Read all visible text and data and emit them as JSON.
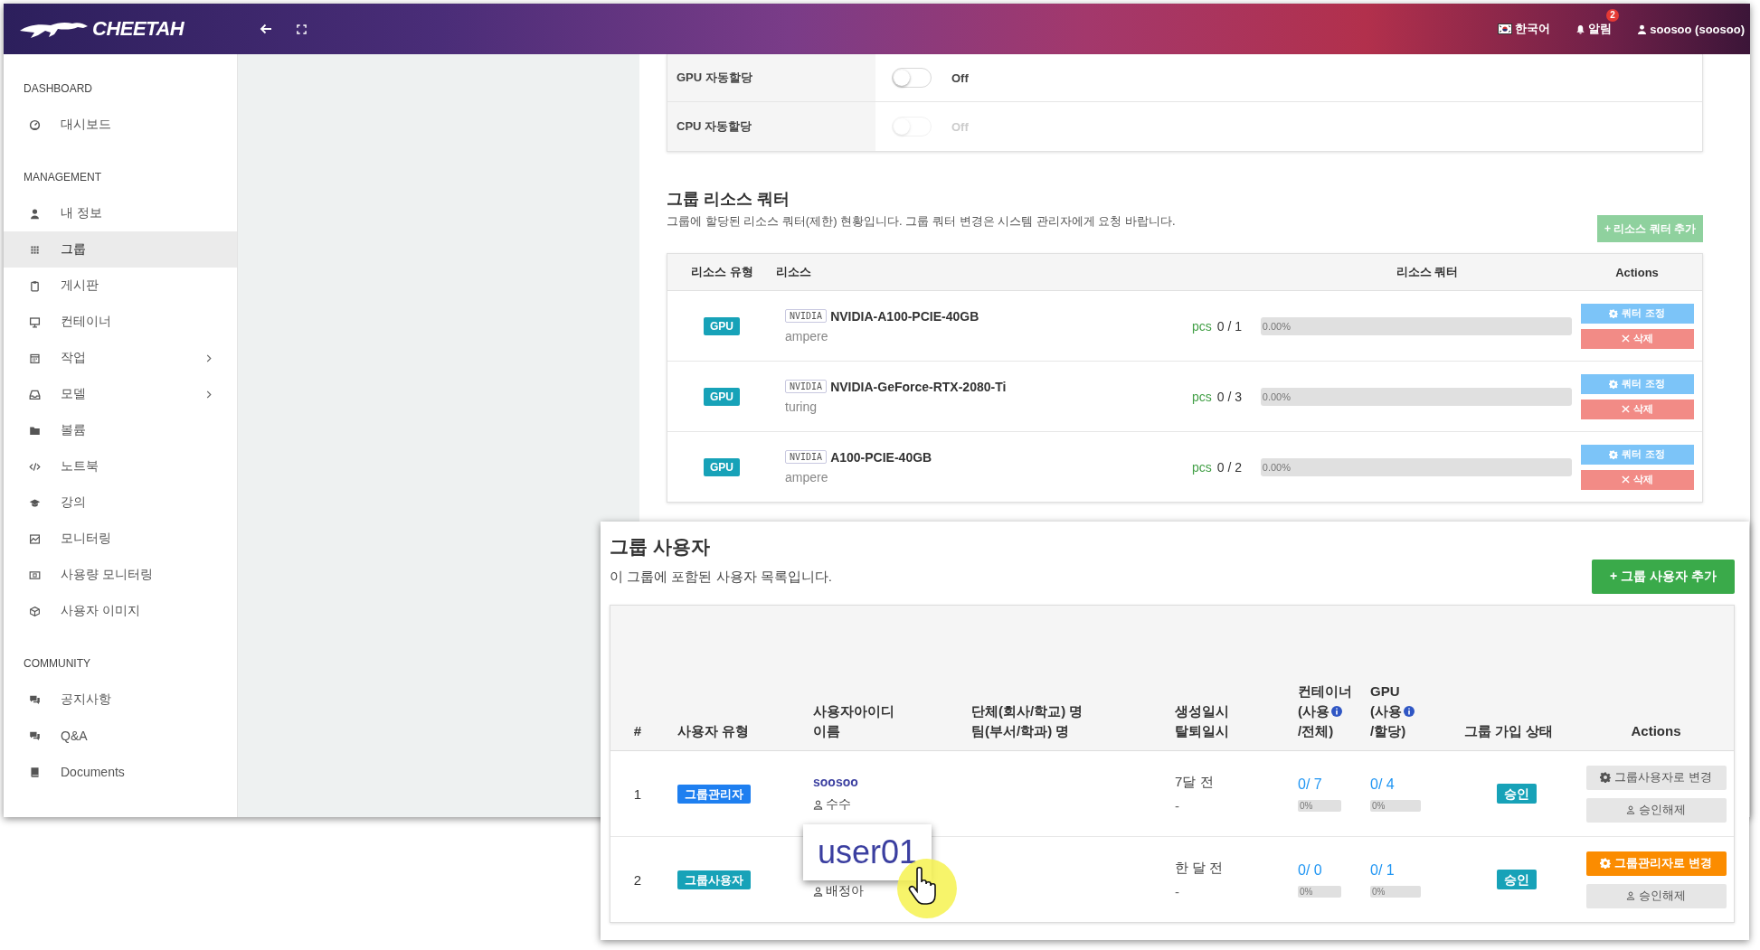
{
  "header": {
    "logo": "CHEETAH",
    "language": "한국어",
    "alerts": {
      "label": "알림",
      "count": "2"
    },
    "user": "soosoo (soosoo)"
  },
  "sidebar": {
    "sections": [
      {
        "title": "DASHBOARD",
        "items": [
          {
            "label": "대시보드",
            "selected": false,
            "expandable": false
          }
        ]
      },
      {
        "title": "MANAGEMENT",
        "items": [
          {
            "label": "내 정보",
            "selected": false,
            "expandable": false
          },
          {
            "label": "그룹",
            "selected": true,
            "expandable": false
          },
          {
            "label": "게시판",
            "selected": false,
            "expandable": false
          },
          {
            "label": "컨테이너",
            "selected": false,
            "expandable": false
          },
          {
            "label": "작업",
            "selected": false,
            "expandable": true
          },
          {
            "label": "모델",
            "selected": false,
            "expandable": true
          },
          {
            "label": "볼륨",
            "selected": false,
            "expandable": false
          },
          {
            "label": "노트북",
            "selected": false,
            "expandable": false
          },
          {
            "label": "강의",
            "selected": false,
            "expandable": false
          },
          {
            "label": "모니터링",
            "selected": false,
            "expandable": false
          },
          {
            "label": "사용량 모니터링",
            "selected": false,
            "expandable": false
          },
          {
            "label": "사용자 이미지",
            "selected": false,
            "expandable": false
          }
        ]
      },
      {
        "title": "COMMUNITY",
        "items": [
          {
            "label": "공지사항",
            "selected": false,
            "expandable": false
          },
          {
            "label": "Q&A",
            "selected": false,
            "expandable": false
          },
          {
            "label": "Documents",
            "selected": false,
            "expandable": false
          }
        ]
      }
    ]
  },
  "settings": [
    {
      "label": "GPU 자동할당",
      "on": false,
      "disabled": false,
      "status": "Off"
    },
    {
      "label": "CPU 자동할당",
      "on": false,
      "disabled": true,
      "status": "Off"
    }
  ],
  "quota": {
    "title": "그룹 리소스 쿼터",
    "description": "그룹에 할당된 리소스 쿼터(제한) 현황입니다. 그룹 쿼터 변경은 시스템 관리자에게 요청 바랍니다.",
    "add_button": "+ 리소스 쿼터 추가",
    "columns": [
      "리소스 유형",
      "리소스",
      "리소스 쿼터",
      "Actions"
    ],
    "rows": [
      {
        "type": "GPU",
        "vendor": "NVIDIA",
        "name": "NVIDIA-A100-PCIE-40GB",
        "arch": "ampere",
        "unit": "pcs",
        "reading": "0 / 1",
        "level": 0,
        "percent": "0.00%",
        "adjust_button": "쿼터 조정",
        "delete_button": "삭제"
      },
      {
        "type": "GPU",
        "vendor": "NVIDIA",
        "name": "NVIDIA-GeForce-RTX-2080-Ti",
        "arch": "turing",
        "unit": "pcs",
        "reading": "0 / 3",
        "level": 0,
        "percent": "0.00%",
        "adjust_button": "쿼터 조정",
        "delete_button": "삭제"
      },
      {
        "type": "GPU",
        "vendor": "NVIDIA",
        "name": "A100-PCIE-40GB",
        "arch": "ampere",
        "unit": "pcs",
        "reading": "0 / 2",
        "level": 0,
        "percent": "0.00%",
        "adjust_button": "쿼터 조정",
        "delete_button": "삭제"
      }
    ]
  },
  "users": {
    "title": "그룹 사용자",
    "description": "이 그룹에 포함된 사용자 목록입니다.",
    "add_button": "+ 그룹 사용자 추가",
    "columns": [
      {
        "lines": [
          "#"
        ]
      },
      {
        "lines": [
          "사용자 유형"
        ]
      },
      {
        "lines": [
          "사용자아이디",
          "이름"
        ]
      },
      {
        "lines": [
          "단체(회사/학교) 명",
          "팀(부서/학과) 명"
        ]
      },
      {
        "lines": [
          "생성일시",
          "탈퇴일시"
        ]
      },
      {
        "lines": [
          "컨테이너",
          "(사용"
        ],
        "after_info": "/전체)"
      },
      {
        "lines": [
          "GPU",
          "(사용"
        ],
        "after_info": "/할당)"
      },
      {
        "lines": [
          "그룹 가입 상태"
        ]
      },
      {
        "lines": [
          "Actions"
        ]
      }
    ],
    "rows": [
      {
        "number": "1",
        "role": {
          "label": "그룹관리자",
          "kind": "admin"
        },
        "user_id": "soosoo",
        "name": "수수",
        "created": "7달 전",
        "left": "-",
        "container": {
          "reading": "0/ 7",
          "level": 0,
          "percent": "0%"
        },
        "gpu": {
          "reading": "0/ 4",
          "level": 0,
          "percent": "0%"
        },
        "status": "승인",
        "change_button": {
          "label": "그룹사용자로 변경",
          "kind": "neutral"
        },
        "revoke_button": "승인해제"
      },
      {
        "number": "2",
        "role": {
          "label": "그룹사용자",
          "kind": "user"
        },
        "name": "배정아",
        "created": "한 달 전",
        "left": "-",
        "container": {
          "reading": "0/ 0",
          "level": 0,
          "percent": "0%"
        },
        "gpu": {
          "reading": "0/ 1",
          "level": 0,
          "percent": "0%"
        },
        "status": "승인",
        "change_button": {
          "label": "그룹관리자로 변경",
          "kind": "warning"
        },
        "revoke_button": "승인해제"
      }
    ]
  },
  "callout": {
    "text": "user01"
  }
}
